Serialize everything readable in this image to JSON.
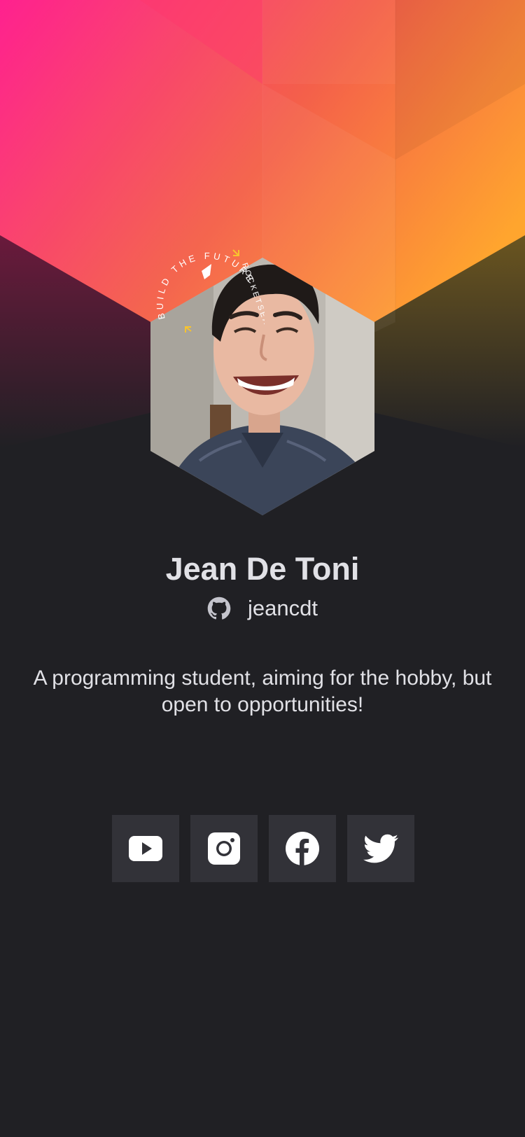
{
  "profile": {
    "name": "Jean De Toni",
    "github_username": "jeancdt",
    "bio": "A programming student, aiming for the hobby, but open to opportunities!",
    "avatar_alt": "Jean De Toni"
  },
  "badge": {
    "text": "BUILD THE FUTURE",
    "brand": "ROCKETSEAT"
  },
  "social_links": [
    {
      "name": "YouTube",
      "icon": "youtube-icon"
    },
    {
      "name": "Instagram",
      "icon": "instagram-icon"
    },
    {
      "name": "Facebook",
      "icon": "facebook-icon"
    },
    {
      "name": "Twitter",
      "icon": "twitter-icon"
    }
  ],
  "colors": {
    "background": "#202024",
    "button": "#323238",
    "text": "#e1e1e6",
    "gradient_start": "#ff1a8c",
    "gradient_end": "#ffa52e",
    "badge_accent": "#f7c32e"
  }
}
